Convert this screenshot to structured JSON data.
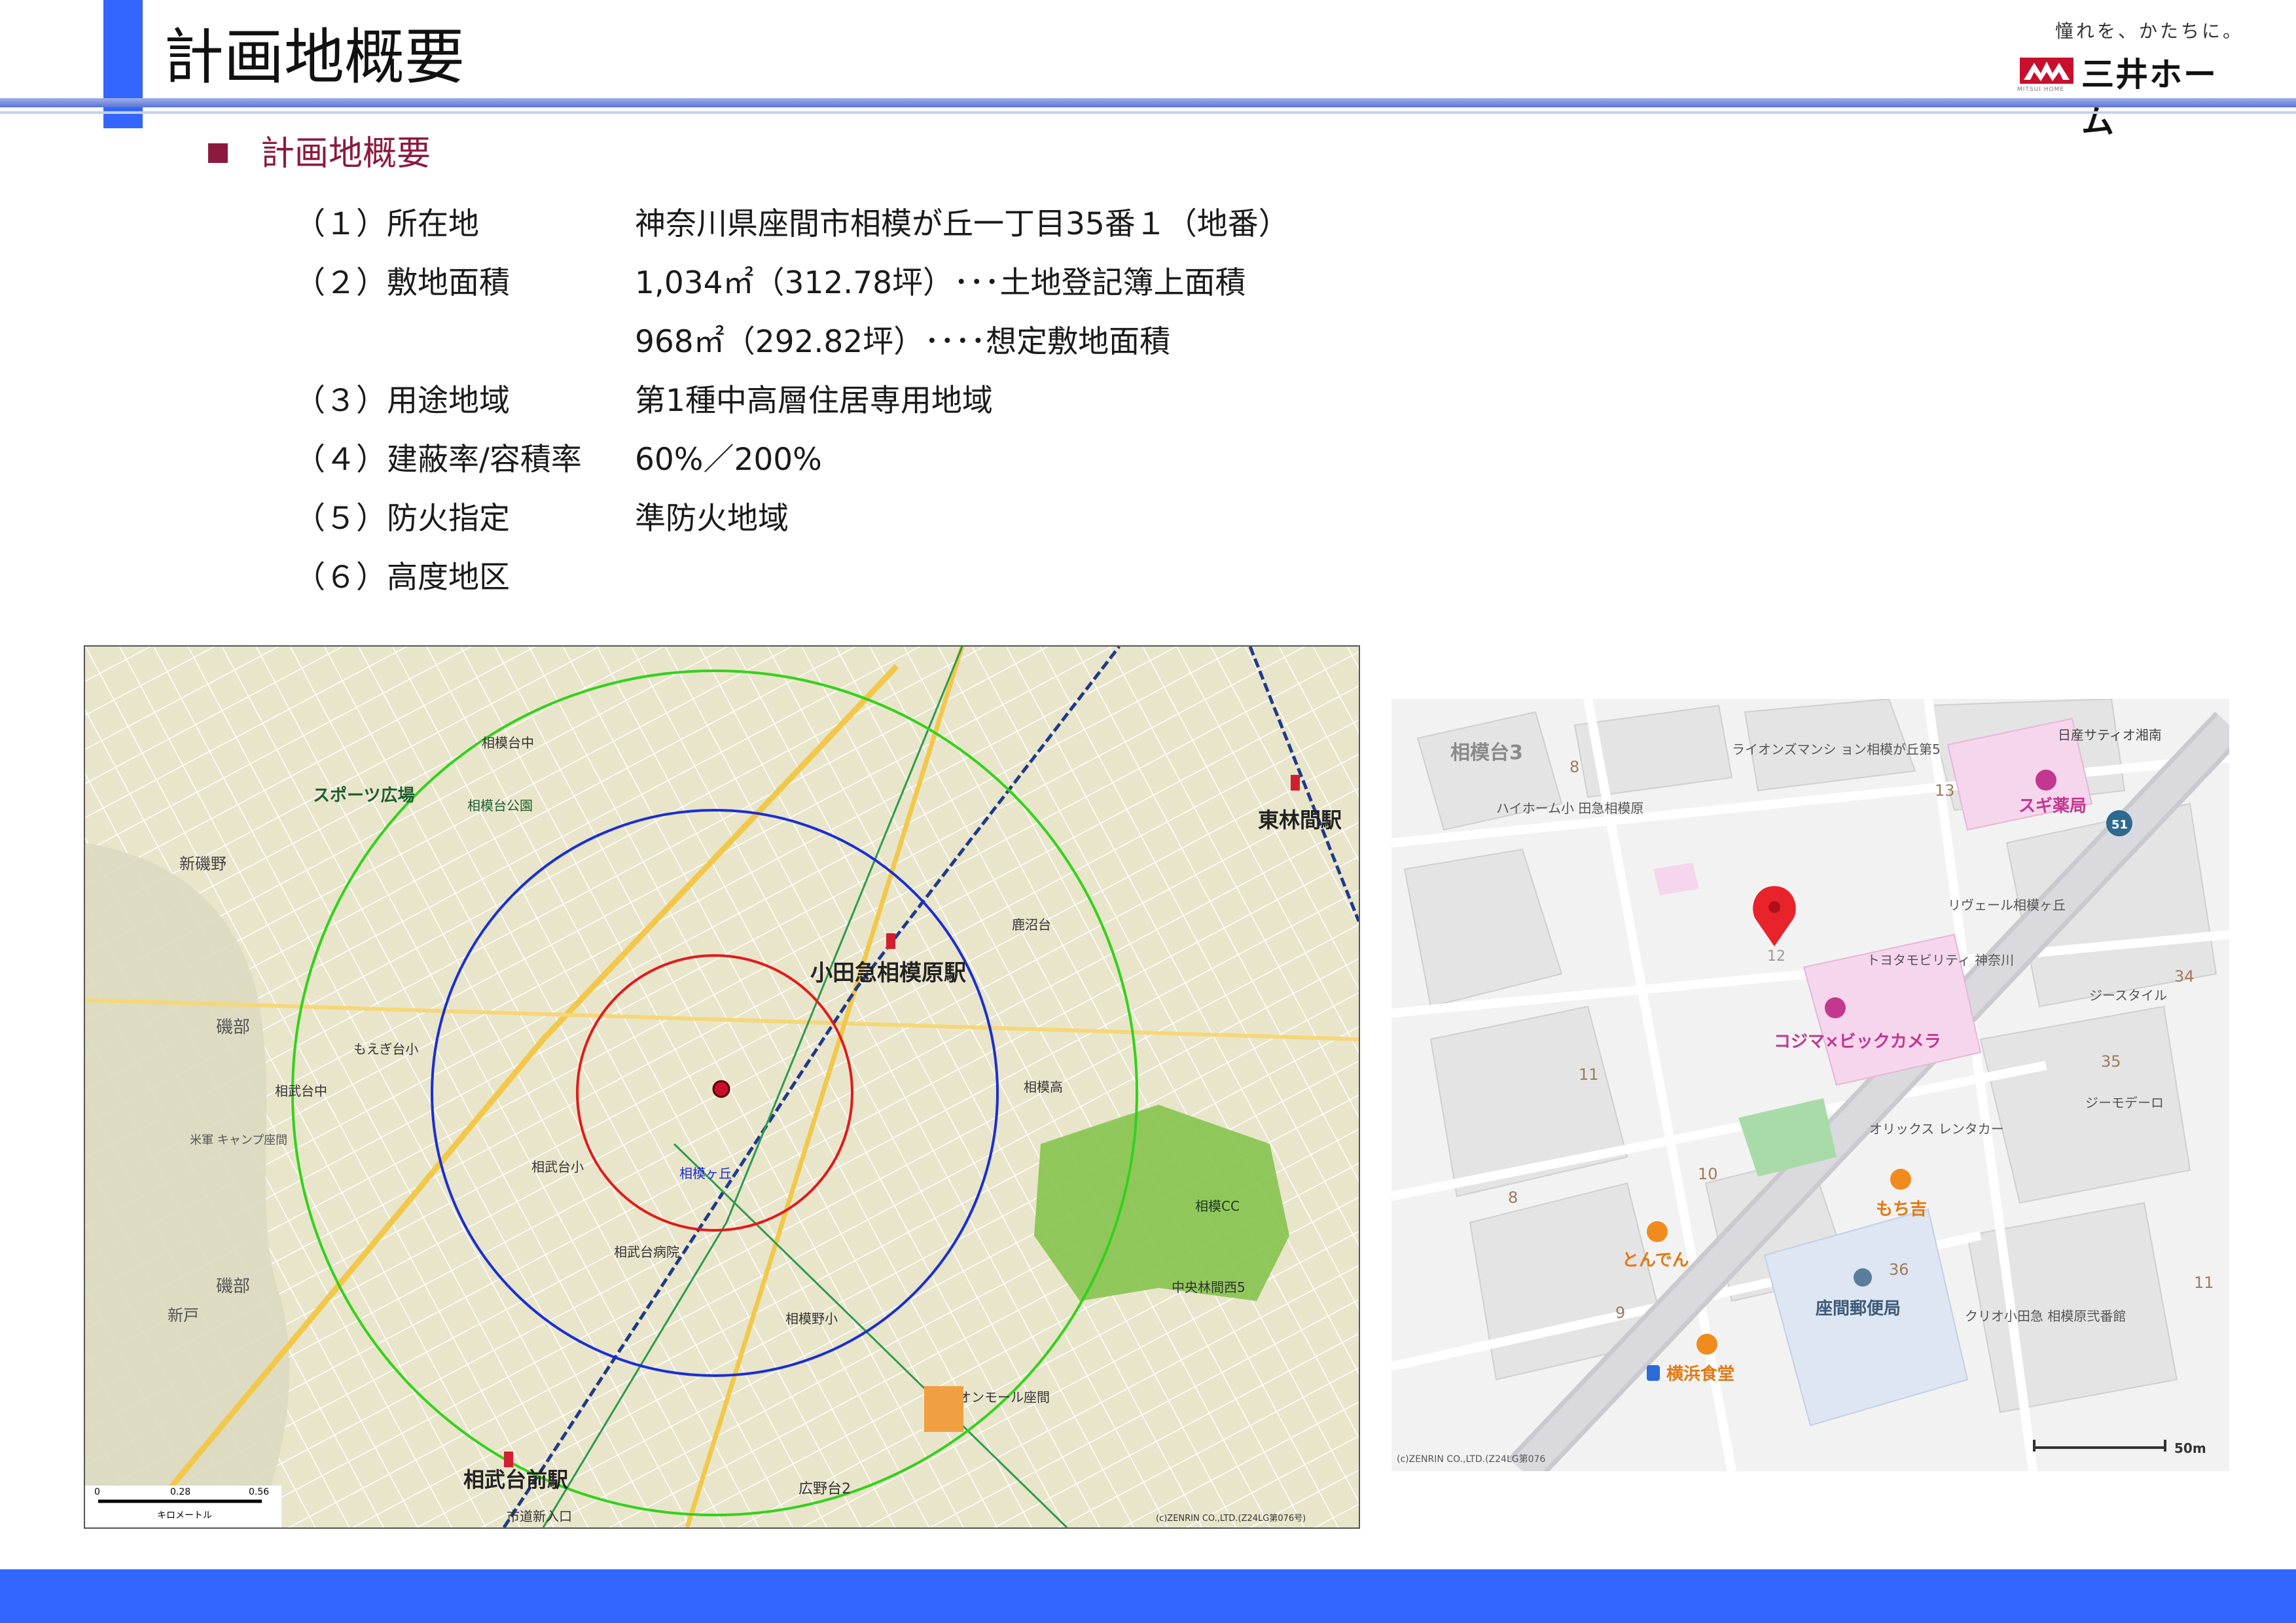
{
  "header": {
    "title": "計画地概要",
    "brand": {
      "tagline": "憧れを、かたちに。",
      "name": "三井ホーム",
      "sub": "MITSUI HOME",
      "colors": {
        "mark": "#c8102e",
        "accent": "#3366ff"
      }
    }
  },
  "section": {
    "heading": "計画地概要",
    "marker_icon": "square-bullet-icon"
  },
  "overview": {
    "rows": [
      {
        "label": "（１）所在地",
        "value": "神奈川県座間市相模が丘一丁目35番１（地番）"
      },
      {
        "label": "（２）敷地面積",
        "value": "1,034㎡（312.78坪）･･･土地登記簿上面積"
      },
      {
        "label": "",
        "value": "968㎡（292.82坪）････想定敷地面積"
      },
      {
        "label": "（３）用途地域",
        "value": "第1種中高層住居専用地域"
      },
      {
        "label": "（４）建蔽率/容積率",
        "value": "60%／200%"
      },
      {
        "label": "（５）防火指定",
        "value": "準防火地域"
      },
      {
        "label": "（６）高度地区",
        "value": ""
      }
    ]
  },
  "area_map": {
    "labels": {
      "station_main": "小田急相模原駅",
      "station_west": "相武台前駅",
      "station_east": "東林間駅",
      "sports": "スポーツ広場",
      "shinisono": "新磯野",
      "isobe1": "磯部",
      "isobe2": "磯部",
      "shinto": "新戸",
      "camp": "米軍\nキャンプ座間",
      "sagamidai": "相模台中",
      "sagamicc": "相模CC",
      "sobudai_park": "相模台公園",
      "shiritsu_iriguchi": "市道新入口",
      "sagamigaoka": "相模ヶ丘",
      "sagamino": "相模野小",
      "sobudai_hosp": "相武台病院",
      "soubu_school": "相武台中",
      "moegi": "もえぎ台小",
      "sobu_kita": "相武台小",
      "kaniwa": "鹿沼台",
      "hiroto": "広野台2",
      "sagami_hs": "相模高",
      "chuo_rinkan": "中央林間西5",
      "ion": "イオンモール座間",
      "scale_0": "0",
      "scale_1": "0.28",
      "scale_2": "0.56",
      "scale_unit": "キロメートル",
      "credit": "(c)ZENRIN CO.,LTD.(Z24LG第076号)"
    }
  },
  "detail_map": {
    "labels": {
      "sagamidai3": "相模台3",
      "n8a": "8",
      "lions": "ライオンズマンシ\nョン相模が丘第5",
      "n13": "13",
      "sugi": "スギ薬局",
      "nissan": "日産サティオ湘南",
      "haihome": "ハイホーム小\n田急相模原",
      "route51": "51",
      "rivere": "リヴェール相模ヶ丘",
      "pin_num": "12",
      "toyota": "トヨタモビリティ\n神奈川",
      "n34": "34",
      "gstyle": "ジースタイル",
      "kojima": "コジマ×ビックカメラ",
      "n35": "35",
      "n11a": "11",
      "gmodello": "ジーモデーロ",
      "orix": "オリックス\nレンタカー",
      "n10": "10",
      "n8b": "8",
      "mochikichi": "もち吉",
      "tonden": "とんでん",
      "n36": "36",
      "post": "座間郵便局",
      "kurio": "クリオ小田急\n相模原弐番館",
      "n11b": "11",
      "n9": "9",
      "yokohama": "横浜食堂",
      "credit": "(c)ZENRIN CO.,LTD.(Z24LG第076",
      "scale": "50m"
    }
  }
}
